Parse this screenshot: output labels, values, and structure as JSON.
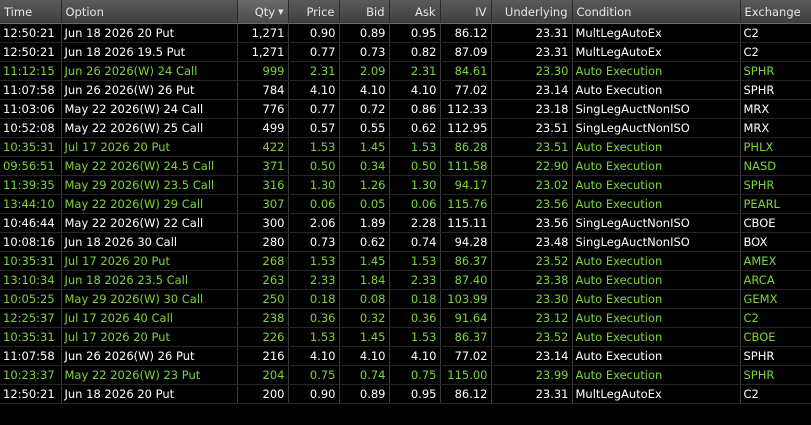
{
  "columns": [
    {
      "key": "time",
      "label": "Time",
      "align": "left"
    },
    {
      "key": "option",
      "label": "Option",
      "align": "left"
    },
    {
      "key": "qty",
      "label": "Qty",
      "align": "right",
      "sorted": true
    },
    {
      "key": "price",
      "label": "Price",
      "align": "right"
    },
    {
      "key": "bid",
      "label": "Bid",
      "align": "right"
    },
    {
      "key": "ask",
      "label": "Ask",
      "align": "right"
    },
    {
      "key": "iv",
      "label": "IV",
      "align": "right"
    },
    {
      "key": "underlying",
      "label": "Underlying",
      "align": "right"
    },
    {
      "key": "condition",
      "label": "Condition",
      "align": "left"
    },
    {
      "key": "exchange",
      "label": "Exchange",
      "align": "left"
    }
  ],
  "sort_indicator": "▼",
  "colors": {
    "white": "#ffffff",
    "green": "#7cd43a",
    "background": "#000000"
  },
  "rows": [
    {
      "style": "white",
      "time": "12:50:21",
      "option": "Jun 18 2026 20 Put",
      "qty": "1,271",
      "price": "0.90",
      "bid": "0.89",
      "ask": "0.95",
      "iv": "86.12",
      "underlying": "23.31",
      "condition": "MultLegAutoEx",
      "exchange": "C2"
    },
    {
      "style": "white",
      "time": "12:50:21",
      "option": "Jun 18 2026 19.5 Put",
      "qty": "1,271",
      "price": "0.77",
      "bid": "0.73",
      "ask": "0.82",
      "iv": "87.09",
      "underlying": "23.31",
      "condition": "MultLegAutoEx",
      "exchange": "C2"
    },
    {
      "style": "green",
      "time": "11:12:15",
      "option": "Jun 26 2026(W) 24 Call",
      "qty": "999",
      "price": "2.31",
      "bid": "2.09",
      "ask": "2.31",
      "iv": "84.61",
      "underlying": "23.30",
      "condition": "Auto Execution",
      "exchange": "SPHR"
    },
    {
      "style": "white",
      "time": "11:07:58",
      "option": "Jun 26 2026(W) 26 Put",
      "qty": "784",
      "price": "4.10",
      "bid": "4.10",
      "ask": "4.10",
      "iv": "77.02",
      "underlying": "23.14",
      "condition": "Auto Execution",
      "exchange": "SPHR"
    },
    {
      "style": "white",
      "time": "11:03:06",
      "option": "May 22 2026(W) 24 Call",
      "qty": "776",
      "price": "0.77",
      "bid": "0.72",
      "ask": "0.86",
      "iv": "112.33",
      "underlying": "23.18",
      "condition": "SingLegAuctNonISO",
      "exchange": "MRX"
    },
    {
      "style": "white",
      "time": "10:52:08",
      "option": "May 22 2026(W) 25 Call",
      "qty": "499",
      "price": "0.57",
      "bid": "0.55",
      "ask": "0.62",
      "iv": "112.95",
      "underlying": "23.51",
      "condition": "SingLegAuctNonISO",
      "exchange": "MRX"
    },
    {
      "style": "green",
      "time": "10:35:31",
      "option": "Jul 17 2026 20 Put",
      "qty": "422",
      "price": "1.53",
      "bid": "1.45",
      "ask": "1.53",
      "iv": "86.28",
      "underlying": "23.51",
      "condition": "Auto Execution",
      "exchange": "PHLX"
    },
    {
      "style": "green",
      "time": "09:56:51",
      "option": "May 22 2026(W) 24.5 Call",
      "qty": "371",
      "price": "0.50",
      "bid": "0.34",
      "ask": "0.50",
      "iv": "111.58",
      "underlying": "22.90",
      "condition": "Auto Execution",
      "exchange": "NASD"
    },
    {
      "style": "green",
      "time": "11:39:35",
      "option": "May 29 2026(W) 23.5 Call",
      "qty": "316",
      "price": "1.30",
      "bid": "1.26",
      "ask": "1.30",
      "iv": "94.17",
      "underlying": "23.02",
      "condition": "Auto Execution",
      "exchange": "SPHR"
    },
    {
      "style": "green",
      "time": "13:44:10",
      "option": "May 22 2026(W) 29 Call",
      "qty": "307",
      "price": "0.06",
      "bid": "0.05",
      "ask": "0.06",
      "iv": "115.76",
      "underlying": "23.56",
      "condition": "Auto Execution",
      "exchange": "PEARL"
    },
    {
      "style": "white",
      "time": "10:46:44",
      "option": "May 22 2026(W) 22 Call",
      "qty": "300",
      "price": "2.06",
      "bid": "1.89",
      "ask": "2.28",
      "iv": "115.11",
      "underlying": "23.56",
      "condition": "SingLegAuctNonISO",
      "exchange": "CBOE"
    },
    {
      "style": "white",
      "time": "10:08:16",
      "option": "Jun 18 2026 30 Call",
      "qty": "280",
      "price": "0.73",
      "bid": "0.62",
      "ask": "0.74",
      "iv": "94.28",
      "underlying": "23.48",
      "condition": "SingLegAuctNonISO",
      "exchange": "BOX"
    },
    {
      "style": "green",
      "time": "10:35:31",
      "option": "Jul 17 2026 20 Put",
      "qty": "268",
      "price": "1.53",
      "bid": "1.45",
      "ask": "1.53",
      "iv": "86.37",
      "underlying": "23.52",
      "condition": "Auto Execution",
      "exchange": "AMEX"
    },
    {
      "style": "green",
      "time": "13:10:34",
      "option": "Jun 18 2026 23.5 Call",
      "qty": "263",
      "price": "2.33",
      "bid": "1.84",
      "ask": "2.33",
      "iv": "87.40",
      "underlying": "23.38",
      "condition": "Auto Execution",
      "exchange": "ARCA"
    },
    {
      "style": "green",
      "time": "10:05:25",
      "option": "May 29 2026(W) 30 Call",
      "qty": "250",
      "price": "0.18",
      "bid": "0.08",
      "ask": "0.18",
      "iv": "103.99",
      "underlying": "23.30",
      "condition": "Auto Execution",
      "exchange": "GEMX"
    },
    {
      "style": "green",
      "time": "12:25:37",
      "option": "Jul 17 2026 40 Call",
      "qty": "238",
      "price": "0.36",
      "bid": "0.32",
      "ask": "0.36",
      "iv": "91.64",
      "underlying": "23.12",
      "condition": "Auto Execution",
      "exchange": "C2"
    },
    {
      "style": "green",
      "time": "10:35:31",
      "option": "Jul 17 2026 20 Put",
      "qty": "226",
      "price": "1.53",
      "bid": "1.45",
      "ask": "1.53",
      "iv": "86.37",
      "underlying": "23.52",
      "condition": "Auto Execution",
      "exchange": "CBOE"
    },
    {
      "style": "white",
      "time": "11:07:58",
      "option": "Jun 26 2026(W) 26 Put",
      "qty": "216",
      "price": "4.10",
      "bid": "4.10",
      "ask": "4.10",
      "iv": "77.02",
      "underlying": "23.14",
      "condition": "Auto Execution",
      "exchange": "SPHR"
    },
    {
      "style": "green",
      "time": "10:23:37",
      "option": "May 22 2026(W) 23 Put",
      "qty": "204",
      "price": "0.75",
      "bid": "0.74",
      "ask": "0.75",
      "iv": "115.00",
      "underlying": "23.99",
      "condition": "Auto Execution",
      "exchange": "SPHR"
    },
    {
      "style": "white",
      "time": "12:50:21",
      "option": "Jun 18 2026 20 Put",
      "qty": "200",
      "price": "0.90",
      "bid": "0.89",
      "ask": "0.95",
      "iv": "86.12",
      "underlying": "23.31",
      "condition": "MultLegAutoEx",
      "exchange": "C2"
    }
  ]
}
